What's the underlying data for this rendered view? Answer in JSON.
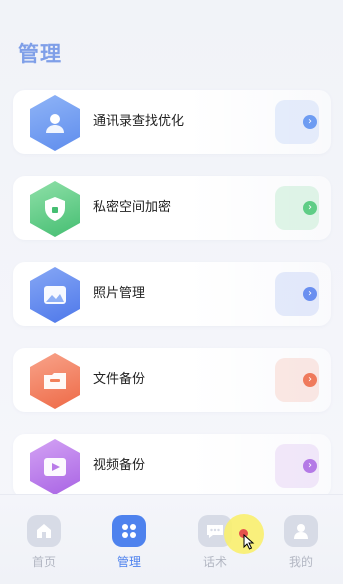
{
  "header": {
    "title": "管理"
  },
  "cards": [
    {
      "label": "通讯录查找优化",
      "icon": "contacts-person-icon",
      "color": "#6e9cf2",
      "chevron_color": "#6e9cf2"
    },
    {
      "label": "私密空间加密",
      "icon": "shield-lock-icon",
      "color": "#5fcd86",
      "chevron_color": "#5fcd86"
    },
    {
      "label": "照片管理",
      "icon": "photo-icon",
      "color": "#5b84ee",
      "chevron_color": "#6a8ff0"
    },
    {
      "label": "文件备份",
      "icon": "folder-icon",
      "color": "#f2805a",
      "chevron_color": "#ef7a5c"
    },
    {
      "label": "视频备份",
      "icon": "video-play-icon",
      "color": "#b97ae8",
      "chevron_color": "#b47ae6"
    }
  ],
  "tabbar": {
    "items": [
      {
        "label": "首页",
        "icon": "home-icon",
        "active": false
      },
      {
        "label": "管理",
        "icon": "grid-icon",
        "active": true
      },
      {
        "label": "话术",
        "icon": "chat-bubble-icon",
        "active": false
      },
      {
        "label": "我的",
        "icon": "user-icon",
        "active": false
      }
    ]
  },
  "colors": {
    "accent": "#4e82ee",
    "title": "#7f9fe8",
    "inactive": "#b3b7c3"
  }
}
